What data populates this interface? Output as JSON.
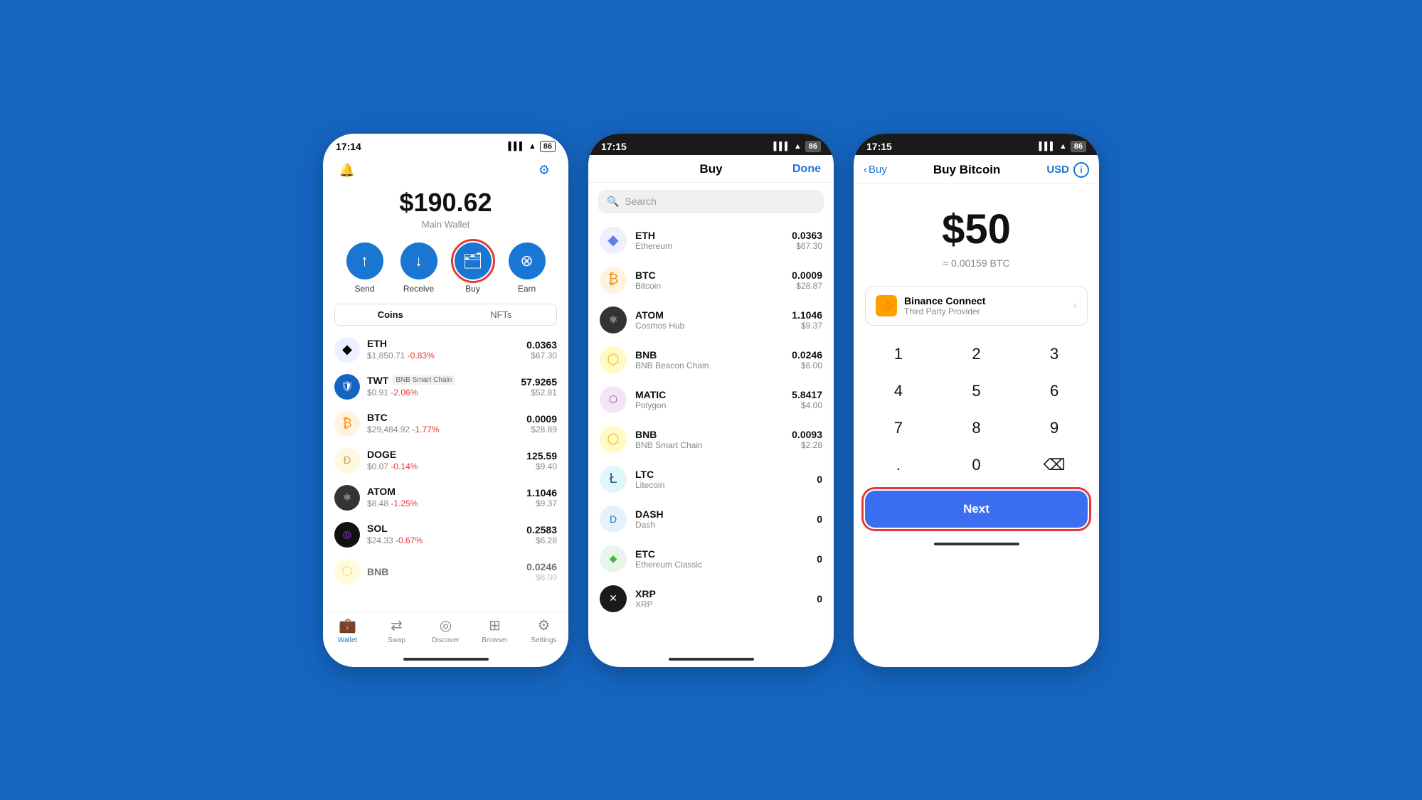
{
  "screen1": {
    "status_time": "17:14",
    "balance": "$190.62",
    "balance_label": "Main Wallet",
    "actions": [
      {
        "label": "Send",
        "icon": "↑",
        "highlighted": false
      },
      {
        "label": "Receive",
        "icon": "↓",
        "highlighted": false
      },
      {
        "label": "Buy",
        "icon": "🗂",
        "highlighted": true
      },
      {
        "label": "Earn",
        "icon": "⊘",
        "highlighted": false
      }
    ],
    "tabs": [
      "Coins",
      "NFTs"
    ],
    "coins": [
      {
        "ticker": "ETH",
        "chain": "",
        "price": "$1,850.71",
        "change": "-0.83%",
        "amount": "0.0363",
        "usd": "$67.30",
        "color_class": "eth-bg",
        "icon": "◆"
      },
      {
        "ticker": "TWT",
        "chain": "BNB Smart Chain",
        "price": "$0.91",
        "change": "-2.06%",
        "amount": "57.9265",
        "usd": "$52.81",
        "color_class": "twt-bg",
        "icon": "🛡"
      },
      {
        "ticker": "BTC",
        "chain": "",
        "price": "$29,484.92",
        "change": "-1.77%",
        "amount": "0.0009",
        "usd": "$28.89",
        "color_class": "btc-bg",
        "icon": "₿"
      },
      {
        "ticker": "DOGE",
        "chain": "",
        "price": "$0.07",
        "change": "-0.14%",
        "amount": "125.59",
        "usd": "$9.40",
        "color_class": "doge-bg",
        "icon": "Ð"
      },
      {
        "ticker": "ATOM",
        "chain": "",
        "price": "$8.48",
        "change": "-1.25%",
        "amount": "1.1046",
        "usd": "$9.37",
        "color_class": "atom-bg",
        "icon": "⚛"
      },
      {
        "ticker": "SOL",
        "chain": "",
        "price": "$24.33",
        "change": "-0.67%",
        "amount": "0.2583",
        "usd": "$6.28",
        "color_class": "sol-bg",
        "icon": "◎"
      },
      {
        "ticker": "BNB",
        "chain": "",
        "price": "",
        "change": "",
        "amount": "0.0246",
        "usd": "$6.00",
        "color_class": "bnb-bg",
        "icon": "⬡"
      }
    ],
    "nav": [
      {
        "label": "Wallet",
        "active": true,
        "icon": "💼"
      },
      {
        "label": "Swap",
        "active": false,
        "icon": "⇄"
      },
      {
        "label": "Discover",
        "active": false,
        "icon": "◎"
      },
      {
        "label": "Browser",
        "active": false,
        "icon": "⊞"
      },
      {
        "label": "Settings",
        "active": false,
        "icon": "⚙"
      }
    ]
  },
  "screen2": {
    "status_time": "17:15",
    "title": "Buy",
    "done_label": "Done",
    "search_placeholder": "Search",
    "coins": [
      {
        "ticker": "ETH",
        "full": "Ethereum",
        "amount": "0.0363",
        "usd": "$67.30",
        "color_class": "eth-bg",
        "icon": "◆"
      },
      {
        "ticker": "BTC",
        "full": "Bitcoin",
        "amount": "0.0009",
        "usd": "$28.87",
        "color_class": "btc-bg",
        "icon": "₿"
      },
      {
        "ticker": "ATOM",
        "full": "Cosmos Hub",
        "amount": "1.1046",
        "usd": "$9.37",
        "color_class": "atom-bg",
        "icon": "⚛"
      },
      {
        "ticker": "BNB",
        "full": "BNB Beacon Chain",
        "amount": "0.0246",
        "usd": "$6.00",
        "color_class": "bnb-bg",
        "icon": "⬡"
      },
      {
        "ticker": "MATIC",
        "full": "Polygon",
        "amount": "5.8417",
        "usd": "$4.00",
        "color_class": "matic-bg",
        "icon": "⬡"
      },
      {
        "ticker": "BNB",
        "full": "BNB Smart Chain",
        "amount": "0.0093",
        "usd": "$2.28",
        "color_class": "bnb-bg",
        "icon": "⬡"
      },
      {
        "ticker": "LTC",
        "full": "Litecoin",
        "amount": "0",
        "usd": "",
        "color_class": "ltc-bg",
        "icon": "Ł"
      },
      {
        "ticker": "DASH",
        "full": "Dash",
        "amount": "0",
        "usd": "",
        "color_class": "dash-bg",
        "icon": "D"
      },
      {
        "ticker": "ETC",
        "full": "Ethereum Classic",
        "amount": "0",
        "usd": "",
        "color_class": "etc-bg",
        "icon": "◆"
      },
      {
        "ticker": "XRP",
        "full": "XRP",
        "amount": "0",
        "usd": "",
        "color_class": "xrp-bg",
        "icon": "✕"
      }
    ]
  },
  "screen3": {
    "status_time": "17:15",
    "back_label": "Buy",
    "title": "Buy Bitcoin",
    "currency": "USD",
    "amount": "$50",
    "amount_btc": "≈ 0.00159 BTC",
    "provider_name": "Binance Connect",
    "provider_sub": "Third Party Provider",
    "numpad": [
      "1",
      "2",
      "3",
      "4",
      "5",
      "6",
      "7",
      "8",
      "9",
      ".",
      "0",
      "⌫"
    ],
    "next_label": "Next"
  }
}
